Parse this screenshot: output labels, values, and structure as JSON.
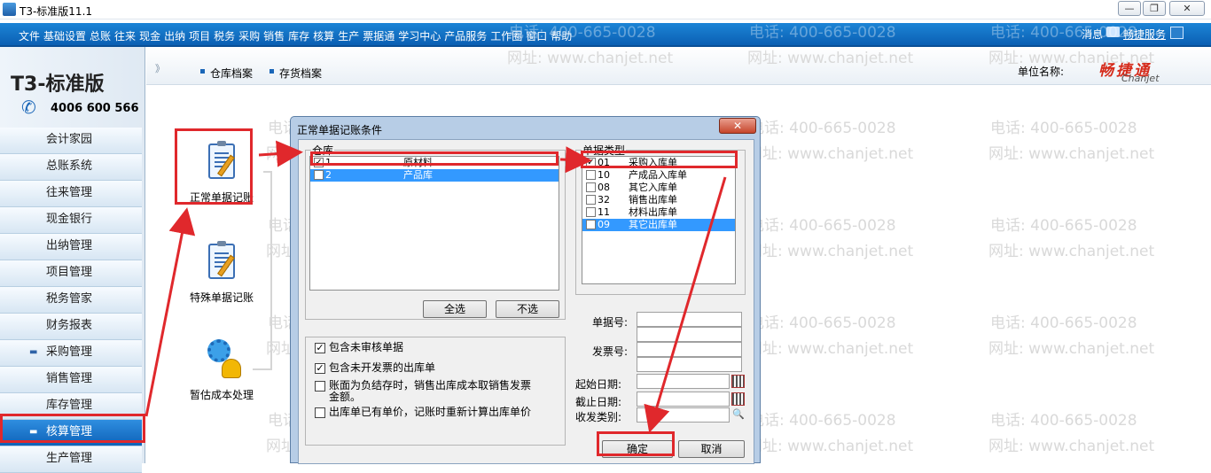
{
  "window": {
    "title": "T3-标准版11.1",
    "buttons": [
      "—",
      "❐",
      "✕"
    ]
  },
  "menu": {
    "items": [
      "文件",
      "基础设置",
      "总账",
      "往来",
      "现金",
      "出纳",
      "项目",
      "税务",
      "采购",
      "销售",
      "库存",
      "核算",
      "生产",
      "票据通",
      "学习中心",
      "产品服务",
      "工作圈",
      "窗口",
      "帮助"
    ],
    "message": "消息",
    "chang_service": "畅捷服务"
  },
  "sidebar": {
    "logo": "T3-标准版",
    "phone": "4006 600 566",
    "items": [
      {
        "label": "会计家园",
        "bullet": ""
      },
      {
        "label": "总账系统",
        "bullet": ""
      },
      {
        "label": "往来管理",
        "bullet": ""
      },
      {
        "label": "现金银行",
        "bullet": ""
      },
      {
        "label": "出纳管理",
        "bullet": ""
      },
      {
        "label": "项目管理",
        "bullet": ""
      },
      {
        "label": "税务管家",
        "bullet": ""
      },
      {
        "label": "财务报表",
        "bullet": ""
      },
      {
        "label": "采购管理",
        "bullet": "▬"
      },
      {
        "label": "销售管理",
        "bullet": ""
      },
      {
        "label": "库存管理",
        "bullet": ""
      },
      {
        "label": "核算管理",
        "bullet": "▬"
      },
      {
        "label": "生产管理",
        "bullet": ""
      }
    ],
    "active_index": 11
  },
  "toolbar": {
    "expand": "》",
    "links": [
      "仓库档案",
      "存货档案"
    ],
    "unit_label": "单位名称:",
    "brand": "畅捷通",
    "brand_en": "Chanjet"
  },
  "functions": [
    "正常单据记账",
    "特殊单据记账",
    "暂估成本处理"
  ],
  "watermark": {
    "phone": "电话: 400-665-0028",
    "site": "网址: www.chanjet.net"
  },
  "dialog": {
    "title": "正常单据记账条件",
    "close": "✕",
    "warehouse": {
      "legend": "仓库",
      "rows": [
        {
          "checked": true,
          "code": "1",
          "name": "原材料",
          "selected": false
        },
        {
          "checked": false,
          "code": "2",
          "name": "产品库",
          "selected": true
        }
      ],
      "select_all": "全选",
      "select_none": "不选"
    },
    "doc_types": {
      "legend": "单据类型",
      "rows": [
        {
          "checked": true,
          "code": "01",
          "name": "采购入库单",
          "selected": false
        },
        {
          "checked": false,
          "code": "10",
          "name": "产成品入库单",
          "selected": false
        },
        {
          "checked": false,
          "code": "08",
          "name": "其它入库单",
          "selected": false
        },
        {
          "checked": false,
          "code": "32",
          "name": "销售出库单",
          "selected": false
        },
        {
          "checked": false,
          "code": "11",
          "name": "材料出库单",
          "selected": false
        },
        {
          "checked": false,
          "code": "09",
          "name": "其它出库单",
          "selected": true
        }
      ]
    },
    "options": [
      {
        "checked": true,
        "text": "包含未审核单据"
      },
      {
        "checked": true,
        "text": "包含未开发票的出库单"
      },
      {
        "checked": false,
        "text": "账面为负结存时，销售出库成本取销售发票",
        "text2": "金额。"
      },
      {
        "checked": false,
        "text": "出库单已有单价，记账时重新计算出库单价"
      }
    ],
    "fields": {
      "doc_no": "单据号:",
      "invoice_no": "发票号:",
      "start_date": "起始日期:",
      "end_date": "截止日期:",
      "category": "收发类别:"
    },
    "ok": "确定",
    "cancel": "取消"
  },
  "colors": {
    "accent": "#0b5fb3",
    "annotation": "#e0282c",
    "selection": "#3399ff"
  }
}
